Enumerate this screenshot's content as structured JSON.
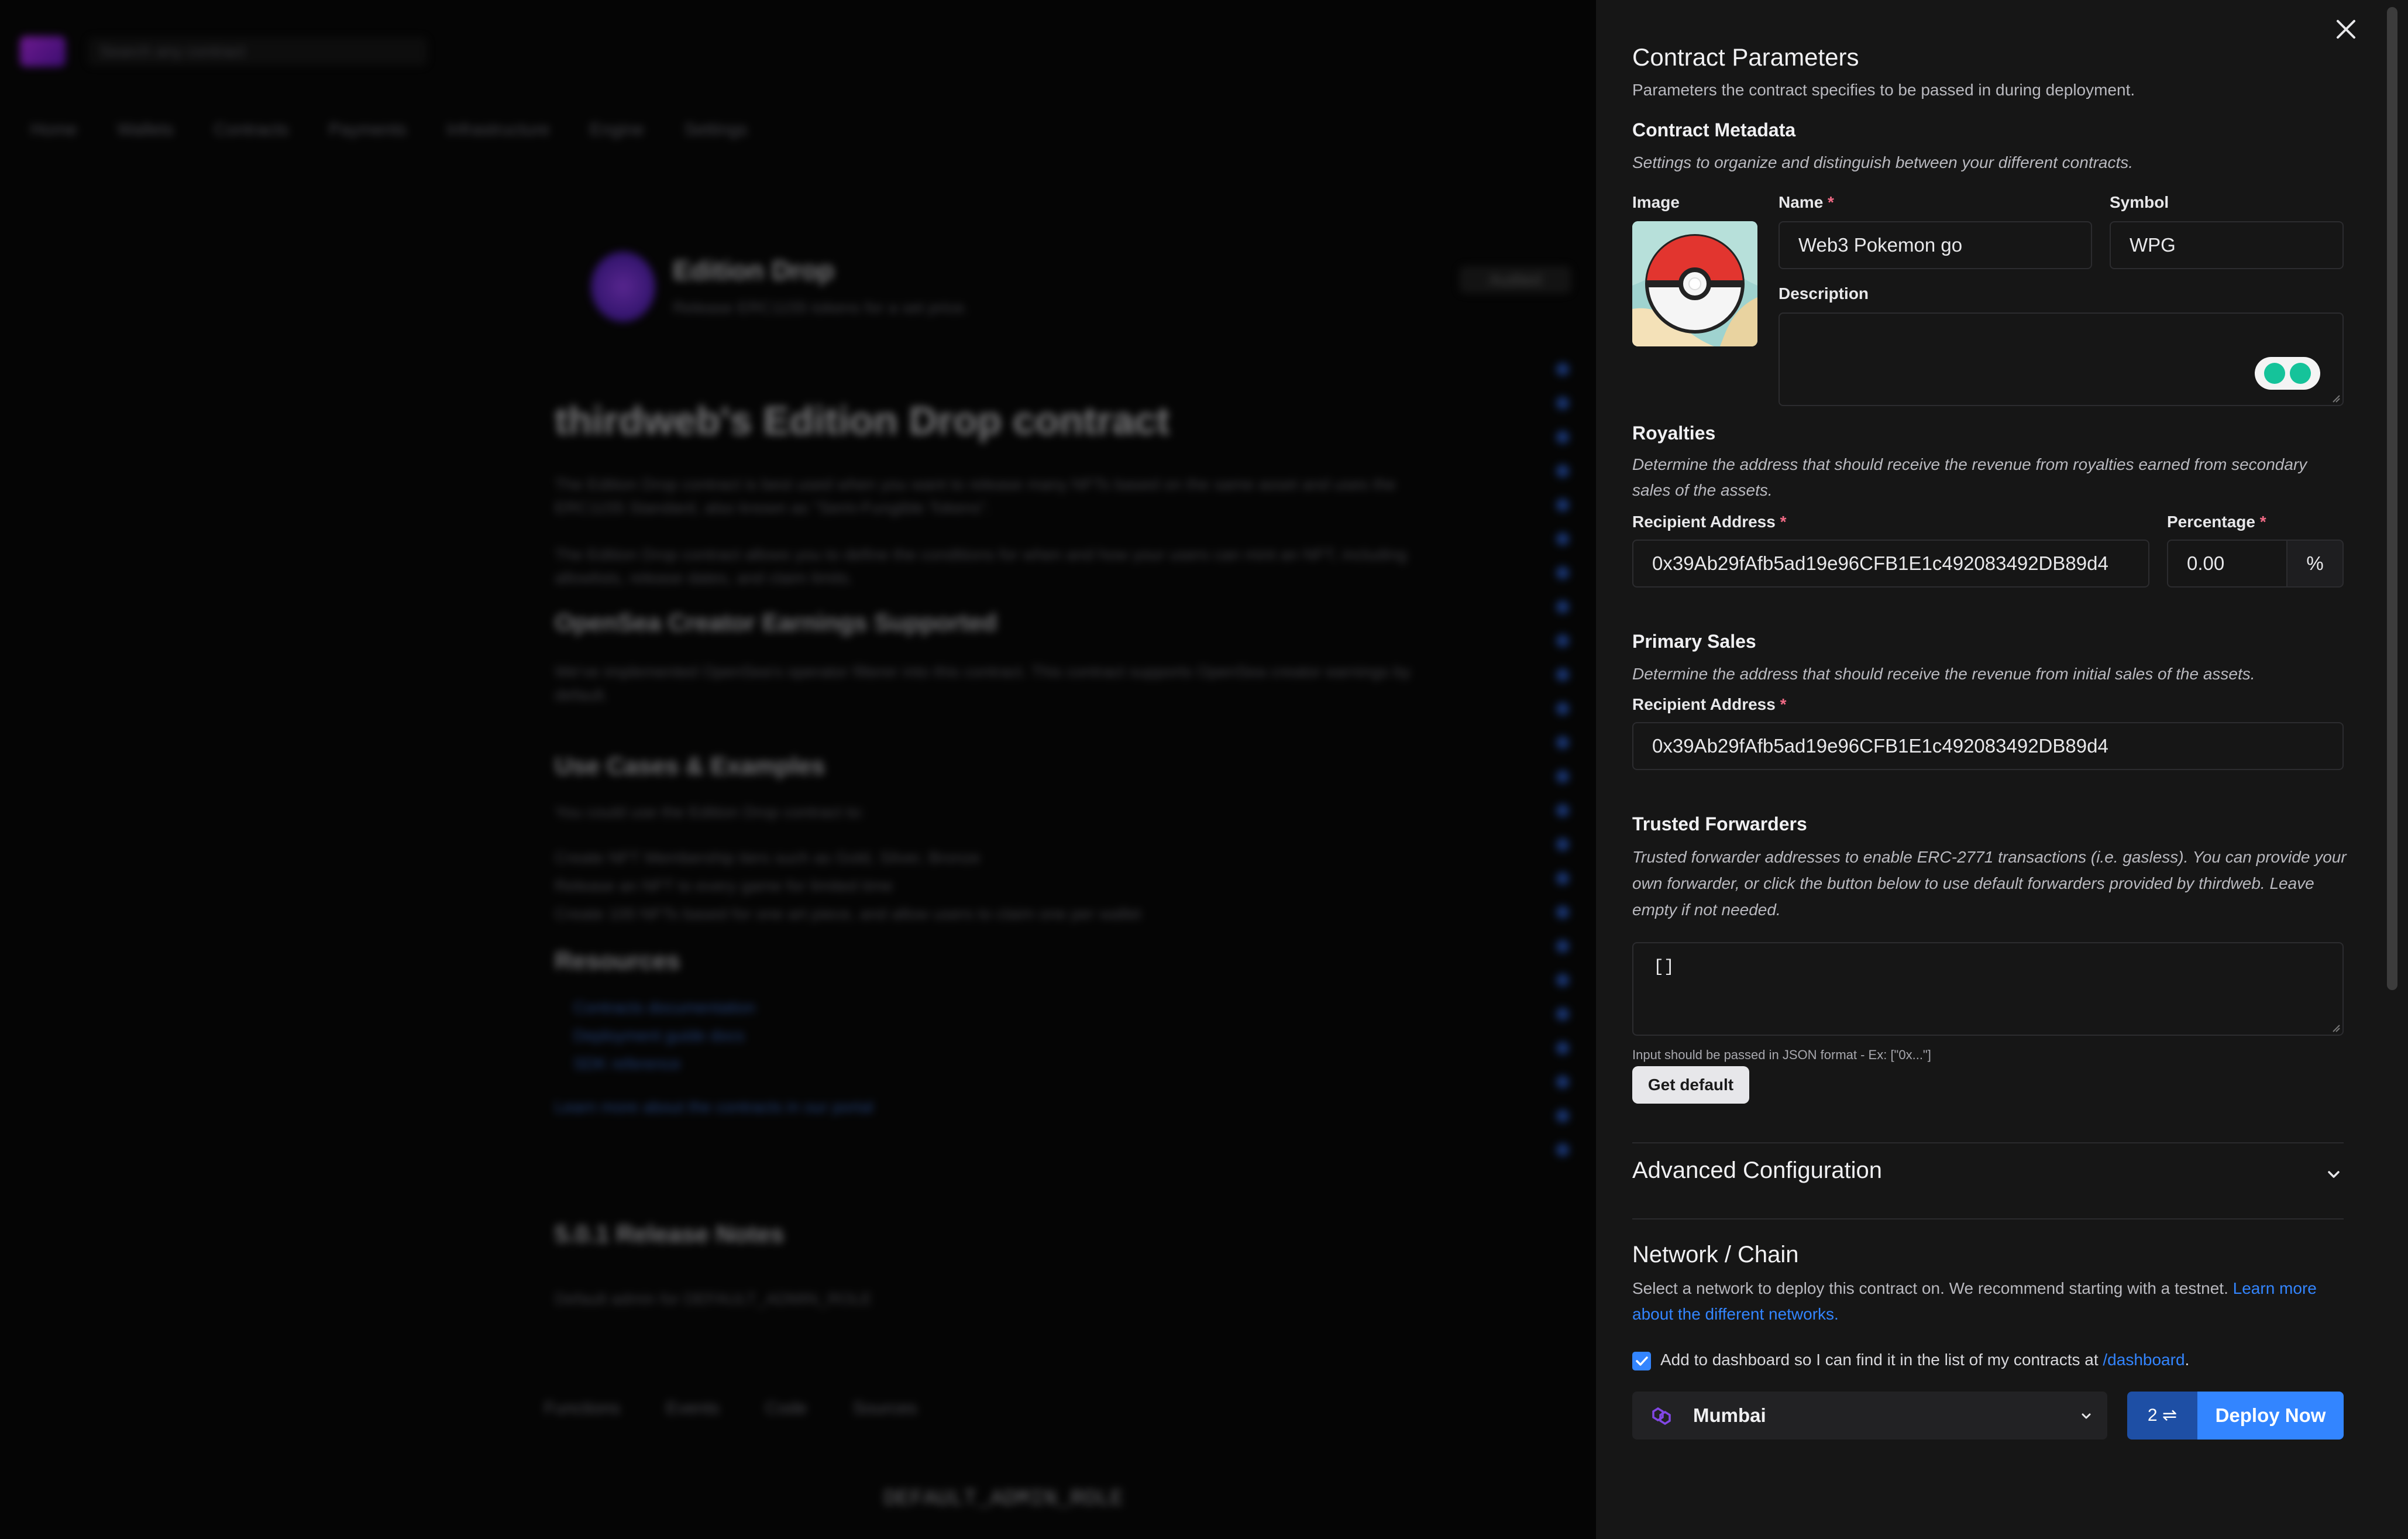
{
  "background": {
    "search_placeholder": "Search any contract",
    "nav": [
      "Home",
      "Wallets",
      "Contracts",
      "Payments",
      "Infrastructure",
      "Engine",
      "Settings"
    ],
    "contract_title": "Edition Drop",
    "contract_subtitle": "Release ERC1155 tokens for a set price.",
    "badge": "Audited",
    "heading": "thirdweb's Edition Drop contract",
    "para1": "The Edition Drop contract is best used when you want to release many NFTs based on the same asset and uses the ERC1155 Standard, also known as \"Semi-Fungible Tokens\".",
    "para2": "The Edition Drop contract allows you to define the conditions for when and how your users can mint an NFT, including allowlists, release dates, and claim limits.",
    "h_royalties": "OpenSea Creator Earnings Supported",
    "para3": "We've implemented OpenSea's operator filterer into this contract. This contract supports OpenSea creator earnings by default.",
    "h_uses": "Use Cases & Examples",
    "para4": "You could use the Edition Drop contract to:",
    "list": [
      "Create NFT Membership tiers such as Gold, Silver, Bronze",
      "Release an NFT to every game for limited time",
      "Create 100 NFTs based for one art piece, and allow users to claim one per wallet"
    ],
    "h_resources": "Resources",
    "links": [
      "Contracts documentation",
      "Deployment guide docs",
      "SDK reference"
    ],
    "link_more": "Learn more about the contracts in our portal",
    "h_release": "5.0.1 Release Notes",
    "release_text": "Default admin for DEFAULT_ADMIN_ROLE",
    "tabs": [
      "Functions",
      "Events",
      "Code",
      "Sources"
    ],
    "code_text": "DEFAULT_ADMIN_ROLE"
  },
  "panel": {
    "title": "Contract Parameters",
    "subtitle": "Parameters the contract specifies to be passed in during deployment.",
    "metadata": {
      "title": "Contract Metadata",
      "description": "Settings to organize and distinguish between your different contracts.",
      "image_label": "Image",
      "name_label": "Name",
      "name_value": "Web3 Pokemon go",
      "symbol_label": "Symbol",
      "symbol_value": "WPG",
      "description_label": "Description",
      "description_value": ""
    },
    "royalties": {
      "title": "Royalties",
      "description": "Determine the address that should receive the revenue from royalties earned from secondary sales of the assets.",
      "recipient_label": "Recipient Address",
      "recipient_value": "0x39Ab29fAfb5ad19e96CFB1E1c492083492DB89d4",
      "percentage_label": "Percentage",
      "percentage_value": "0.00",
      "percent_symbol": "%"
    },
    "primary_sales": {
      "title": "Primary Sales",
      "description": "Determine the address that should receive the revenue from initial sales of the assets.",
      "recipient_label": "Recipient Address",
      "recipient_value": "0x39Ab29fAfb5ad19e96CFB1E1c492083492DB89d4"
    },
    "trusted_forwarders": {
      "title": "Trusted Forwarders",
      "description": "Trusted forwarder addresses to enable ERC-2771 transactions (i.e. gasless). You can provide your own forwarder, or click the button below to use default forwarders provided by thirdweb. Leave empty if not needed.",
      "value": "[]",
      "hint": "Input should be passed in JSON format - Ex: [\"0x...\"]",
      "button": "Get default"
    },
    "advanced": {
      "title": "Advanced Configuration"
    },
    "network": {
      "title": "Network / Chain",
      "description": "Select a network to deploy this contract on. We recommend starting with a testnet.",
      "link": "Learn more about the different networks.",
      "checkbox_text": "Add to dashboard so I can find it in the list of my contracts at",
      "checkbox_link": "/dashboard",
      "checkbox_period": ".",
      "checked": true,
      "selected_network": "Mumbai",
      "tx_count": "2",
      "deploy_button": "Deploy Now"
    }
  },
  "colors": {
    "accent": "#3385ff",
    "required": "#f06a85",
    "panel_bg": "#161616",
    "polygon": "#8247e5"
  },
  "icons": {
    "close": "close-icon",
    "chevron": "chevron-down-icon",
    "polygon": "polygon-icon",
    "swap": "swap-arrows-icon",
    "grammarly": "grammarly-icon",
    "checkbox": "checkbox-checked-icon"
  }
}
